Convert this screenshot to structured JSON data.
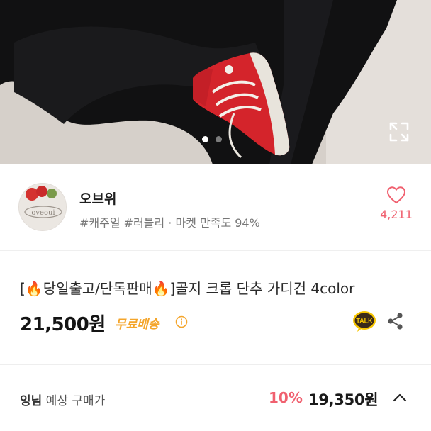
{
  "hero": {
    "slide_count": 2,
    "active_slide": 0,
    "expand_icon": "fullscreen-expand-icon"
  },
  "seller": {
    "avatar_text": "oveoui",
    "name": "오브위",
    "tags": "#캐주얼 #러블리 · 마켓 만족도 94%",
    "like_count": "4,211",
    "heart_icon": "heart-outline-icon"
  },
  "product": {
    "title": "[🔥당일출고/단독판매🔥]골지 크롭 단추 가디건 4color",
    "price": "21,500원",
    "shipping_label": "무료배송",
    "info_icon": "info-circle-icon",
    "talk_label": "TALK",
    "share_icon": "share-icon"
  },
  "price_bar": {
    "user_name": "잉님",
    "label": "예상 구매가",
    "discount": "10%",
    "final_price": "19,350원",
    "chevron_icon": "chevron-up-icon"
  },
  "colors": {
    "accent_pink": "#f0606f",
    "shipping_orange": "#f4a52b",
    "talk_yellow": "#f7c600"
  }
}
